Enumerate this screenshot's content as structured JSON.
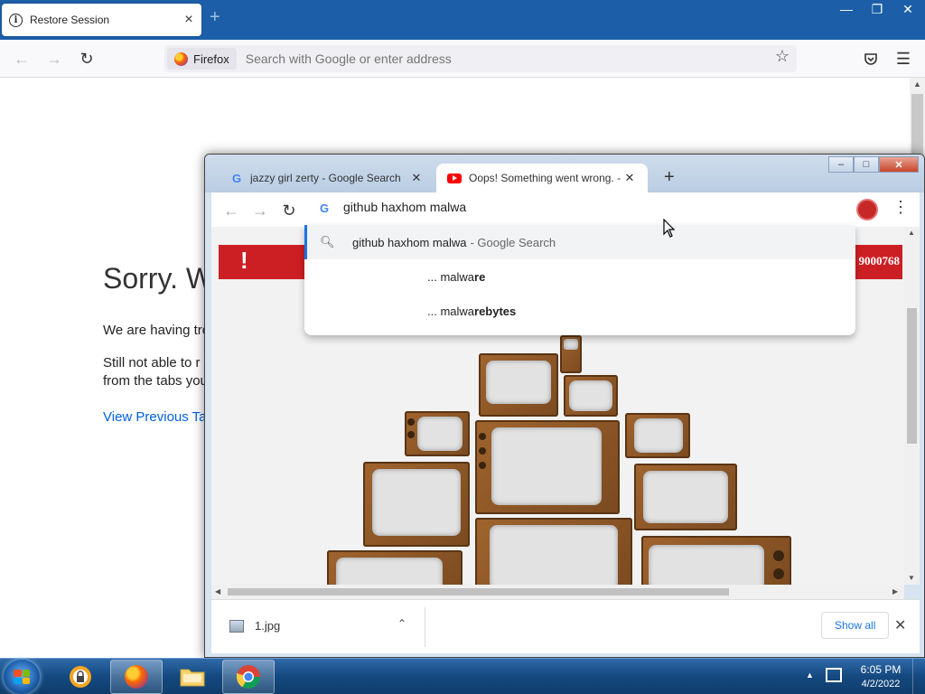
{
  "firefox": {
    "tab_title": "Restore Session",
    "tab_close": "×",
    "new_tab": "+",
    "identity_label": "Firefox",
    "url_placeholder": "Search with Google or enter address",
    "content": {
      "heading": "Sorry. W",
      "p1": "We are having tro",
      "p2_line1": "Still not able to r",
      "p2_line2": "from the tabs you",
      "link": "View Previous Ta"
    }
  },
  "chrome": {
    "tabs": [
      {
        "title": "jazzy girl zerty - Google Search",
        "icon": "google-g-icon"
      },
      {
        "title": "Oops! Something went wrong. -",
        "icon": "youtube-icon"
      }
    ],
    "new_tab": "+",
    "omnibox_value": "github haxhom malwa",
    "dropdown": {
      "row1_query": "github haxhom malwa",
      "row1_suffix": "- Google Search",
      "suggestions": [
        {
          "prefix": "... malwa",
          "bold": "re"
        },
        {
          "prefix": "... malwa",
          "bold": "rebytes"
        }
      ]
    },
    "page": {
      "banner_code": "9000768",
      "banner_mark": "!"
    },
    "downloads": {
      "file_name": "1.jpg",
      "show_all": "Show all"
    }
  },
  "taskbar": {
    "time": "6:05 PM",
    "date": "4/2/2022"
  },
  "colors": {
    "firefox_titlebar": "#1c5fa8",
    "youtube_banner": "#cc1f24",
    "chrome_link": "#1a73e8"
  }
}
